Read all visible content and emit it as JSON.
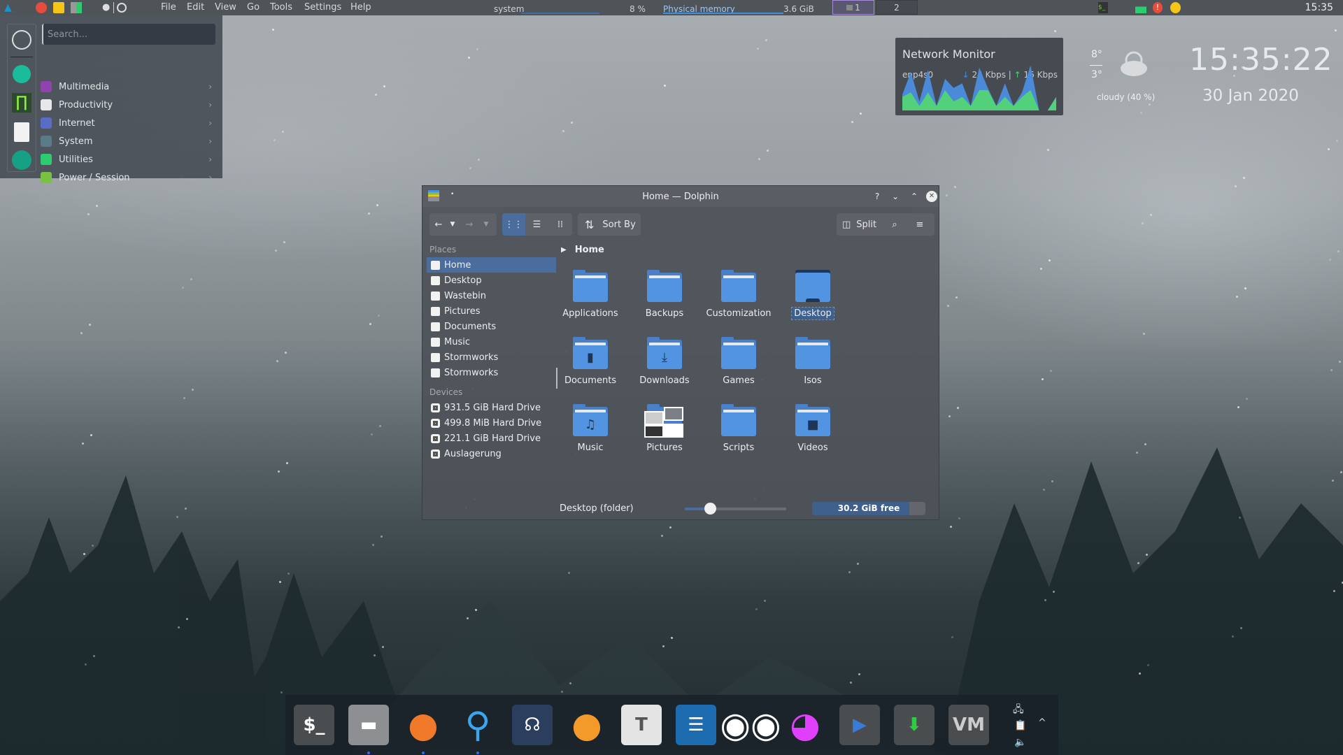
{
  "topbar": {
    "menu": [
      "File",
      "Edit",
      "View",
      "Go",
      "Tools",
      "Settings",
      "Help"
    ],
    "icons": [
      "arch-linux-icon",
      "color-picker-icon",
      "notes-icon",
      "calculator-icon",
      "water-drop-icon",
      "separator-icon",
      "circle-icon"
    ],
    "cpu": {
      "label": "system",
      "value": "8 %",
      "percent": 8
    },
    "memory": {
      "label": "Physical memory",
      "value": "3.6 GiB",
      "percent": 100
    },
    "pager": [
      {
        "label": "1",
        "active": true
      },
      {
        "label": "2",
        "active": false
      }
    ],
    "tray_icons": [
      "terminal-icon",
      "system-monitor-icon",
      "warning-icon",
      "pacman-icon"
    ],
    "clock": "15:35"
  },
  "launcher": {
    "search_placeholder": "Search...",
    "favorites": [
      "power-icon",
      "settings-wrench-icon",
      "oscilloscope-icon",
      "document-icon",
      "aperture-icon"
    ],
    "categories": [
      {
        "label": "Multimedia",
        "icon": "multimedia-icon",
        "color": "#8e44ad"
      },
      {
        "label": "Productivity",
        "icon": "productivity-icon",
        "color": "#e8e8e8"
      },
      {
        "label": "Internet",
        "icon": "internet-icon",
        "color": "#5b6cc4"
      },
      {
        "label": "System",
        "icon": "system-icon",
        "color": "#5a7a8a"
      },
      {
        "label": "Utilities",
        "icon": "utilities-icon",
        "color": "#2ecc71"
      },
      {
        "label": "Power / Session",
        "icon": "power-session-icon",
        "color": "#7ac142"
      }
    ]
  },
  "network_monitor": {
    "title": "Network Monitor",
    "interface": "enp4s0",
    "down": "24 Kbps",
    "separator": "|",
    "up": "16 Kbps",
    "download_series": [
      0.35,
      0.85,
      0.2,
      0.9,
      0.1,
      0.7,
      0.5,
      0.6,
      0.1,
      0.95,
      0.5,
      0.1,
      0.6,
      0.1,
      0.4,
      1.0,
      0.0,
      0.0,
      0.3
    ],
    "upload_series": [
      0.3,
      0.4,
      0.1,
      0.4,
      0.1,
      0.45,
      0.2,
      0.3,
      0.1,
      0.45,
      0.45,
      0.1,
      0.3,
      0.1,
      0.3,
      0.45,
      0.0,
      0.0,
      0.3
    ],
    "colors": {
      "down": "#4a8ad8",
      "up": "#52d07a"
    }
  },
  "weather": {
    "high": "8°",
    "low": "3°",
    "condition": "cloudy (40 %)"
  },
  "desktop_clock": {
    "time": "15:35:22",
    "date": "30 Jan 2020"
  },
  "dolphin": {
    "title": "Home — Dolphin",
    "titlebar_buttons": {
      "help": "?",
      "minimize": "⌄",
      "maximize": "⌃",
      "close": "✕"
    },
    "toolbar": {
      "back": "←",
      "forward": "→",
      "sort_by": "Sort By",
      "split": "Split"
    },
    "places_header": "Places",
    "places": [
      {
        "label": "Home",
        "icon": "home-icon",
        "selected": true
      },
      {
        "label": "Desktop",
        "icon": "desktop-icon"
      },
      {
        "label": "Wastebin",
        "icon": "trash-icon"
      },
      {
        "label": "Pictures",
        "icon": "pictures-icon"
      },
      {
        "label": "Documents",
        "icon": "documents-icon"
      },
      {
        "label": "Music",
        "icon": "music-icon"
      },
      {
        "label": "Stormworks",
        "icon": "folder-icon"
      },
      {
        "label": "Stormworks",
        "icon": "folder-icon"
      }
    ],
    "devices_header": "Devices",
    "devices": [
      {
        "label": "931.5 GiB Hard Drive"
      },
      {
        "label": "499.8 MiB Hard Drive"
      },
      {
        "label": "221.1 GiB Hard Drive"
      },
      {
        "label": "Auslagerung"
      }
    ],
    "breadcrumb": "Home",
    "files": [
      {
        "label": "Applications",
        "emblem": ""
      },
      {
        "label": "Backups",
        "emblem": ""
      },
      {
        "label": "Customization",
        "emblem": ""
      },
      {
        "label": "Desktop",
        "emblem": "",
        "selected": true
      },
      {
        "label": "Documents",
        "emblem": "▮"
      },
      {
        "label": "Downloads",
        "emblem": "⤓"
      },
      {
        "label": "Games",
        "emblem": ""
      },
      {
        "label": "Isos",
        "emblem": ""
      },
      {
        "label": "Music",
        "emblem": "♫"
      },
      {
        "label": "Pictures",
        "emblem": "▦"
      },
      {
        "label": "Scripts",
        "emblem": ""
      },
      {
        "label": "Videos",
        "emblem": "■"
      }
    ],
    "status": "Desktop (folder)",
    "zoom_level_percent": 25,
    "free_space": "30.2 GiB free",
    "disk_used_percent": 86
  },
  "dock": {
    "apps": [
      {
        "name": "terminal",
        "glyph": "$_",
        "bg": "#4a4d50",
        "fg": "#fff",
        "running": false
      },
      {
        "name": "file-manager",
        "glyph": "▬",
        "bg": "#8d8f92",
        "fg": "#fff",
        "running": true
      },
      {
        "name": "firefox",
        "glyph": "●",
        "bg": "transparent",
        "fg": "#f07a2a",
        "running": true
      },
      {
        "name": "steam",
        "glyph": "⚲",
        "bg": "transparent",
        "fg": "#3aa6f0",
        "running": true
      },
      {
        "name": "teamspeak",
        "glyph": "☊",
        "bg": "#2c3e5e",
        "fg": "#fff",
        "running": false
      },
      {
        "name": "otter-browser",
        "glyph": "●",
        "bg": "transparent",
        "fg": "#f39a2a",
        "running": false
      },
      {
        "name": "text-editor",
        "glyph": "T",
        "bg": "#e4e4e4",
        "fg": "#555",
        "running": false
      },
      {
        "name": "notes-list",
        "glyph": "☰",
        "bg": "#1e6cb0",
        "fg": "#fff",
        "running": false
      },
      {
        "name": "gimp",
        "glyph": "◉◉",
        "bg": "transparent",
        "fg": "#fff",
        "running": false
      },
      {
        "name": "krita",
        "glyph": "◕",
        "bg": "transparent",
        "fg": "#e040fb",
        "running": false
      },
      {
        "name": "kdenlive",
        "glyph": "▶",
        "bg": "#4a4d50",
        "fg": "#3a7ad8",
        "running": false
      },
      {
        "name": "usb-creator",
        "glyph": "⬇",
        "bg": "#4a4d50",
        "fg": "#2ecc40",
        "running": false
      },
      {
        "name": "virt-manager",
        "glyph": "VM",
        "bg": "#4a4d50",
        "fg": "#ccc",
        "running": false
      }
    ],
    "tray": [
      "network-icon",
      "clipboard-icon",
      "volume-icon",
      "expand-tray-icon"
    ]
  }
}
